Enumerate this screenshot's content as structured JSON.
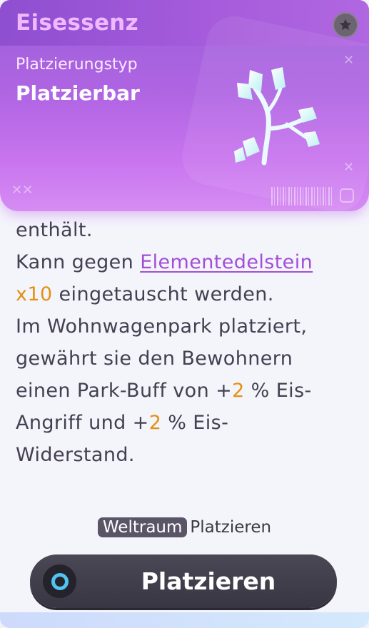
{
  "item": {
    "name": "Eisessenz",
    "placement_type_label": "Platzierungstyp",
    "placement_type_value": "Platzierbar",
    "icon": "ice-crystal-branch",
    "favorite_icon": "star-icon"
  },
  "description": {
    "l1": "enthält.",
    "l2_pre": "Kann gegen ",
    "l2_link": "Elementedelstein",
    "l3_num": "x10",
    "l3_post": " eingetauscht werden.",
    "l4": "Im Wohnwagenpark platziert,",
    "l5": "gewährt sie den Bewohnern",
    "l6_pre": "einen Park-Buff von +",
    "l6_num": "2",
    "l6_post": " % Eis-",
    "l7_pre": "Angriff und +",
    "l7_num": "2",
    "l7_post": " % Eis-",
    "l8": "Widerstand."
  },
  "placement": {
    "tag": "Weltraum",
    "text": "Platzieren"
  },
  "primary_button": {
    "label": "Platzieren",
    "icon": "ring-icon"
  },
  "colors": {
    "header_purple": "#b065e3",
    "accent_number": "#e39113",
    "link_purple": "#a24ed9",
    "button_dark": "#3f3d4a",
    "ring_cyan": "#52c3f0"
  }
}
